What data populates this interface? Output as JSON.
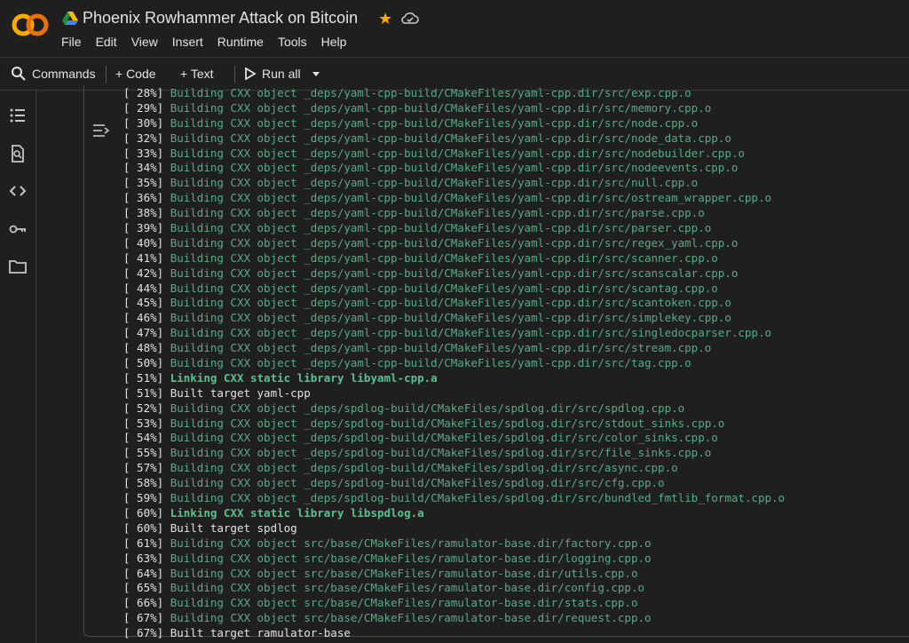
{
  "header": {
    "logo_text": "CO",
    "title": "Phoenix Rowhammer Attack on Bitcoin",
    "menu": [
      "File",
      "Edit",
      "View",
      "Insert",
      "Runtime",
      "Tools",
      "Help"
    ]
  },
  "toolbar": {
    "commands_label": "Commands",
    "code_label": "+ Code",
    "text_label": "+ Text",
    "run_all_label": "Run all"
  },
  "colors": {
    "accent_star": "#f9ab00",
    "logo_orange": "#f9ab00",
    "build_text": "#5aa987",
    "link_text": "#57c28f"
  },
  "output_lines": [
    {
      "pct": "[ 28%]",
      "msg": "Building CXX object _deps/yaml-cpp-build/CMakeFiles/yaml-cpp.dir/src/exp.cpp.o",
      "kind": "build"
    },
    {
      "pct": "[ 29%]",
      "msg": "Building CXX object _deps/yaml-cpp-build/CMakeFiles/yaml-cpp.dir/src/memory.cpp.o",
      "kind": "build"
    },
    {
      "pct": "[ 30%]",
      "msg": "Building CXX object _deps/yaml-cpp-build/CMakeFiles/yaml-cpp.dir/src/node.cpp.o",
      "kind": "build"
    },
    {
      "pct": "[ 32%]",
      "msg": "Building CXX object _deps/yaml-cpp-build/CMakeFiles/yaml-cpp.dir/src/node_data.cpp.o",
      "kind": "build"
    },
    {
      "pct": "[ 33%]",
      "msg": "Building CXX object _deps/yaml-cpp-build/CMakeFiles/yaml-cpp.dir/src/nodebuilder.cpp.o",
      "kind": "build"
    },
    {
      "pct": "[ 34%]",
      "msg": "Building CXX object _deps/yaml-cpp-build/CMakeFiles/yaml-cpp.dir/src/nodeevents.cpp.o",
      "kind": "build"
    },
    {
      "pct": "[ 35%]",
      "msg": "Building CXX object _deps/yaml-cpp-build/CMakeFiles/yaml-cpp.dir/src/null.cpp.o",
      "kind": "build"
    },
    {
      "pct": "[ 36%]",
      "msg": "Building CXX object _deps/yaml-cpp-build/CMakeFiles/yaml-cpp.dir/src/ostream_wrapper.cpp.o",
      "kind": "build"
    },
    {
      "pct": "[ 38%]",
      "msg": "Building CXX object _deps/yaml-cpp-build/CMakeFiles/yaml-cpp.dir/src/parse.cpp.o",
      "kind": "build"
    },
    {
      "pct": "[ 39%]",
      "msg": "Building CXX object _deps/yaml-cpp-build/CMakeFiles/yaml-cpp.dir/src/parser.cpp.o",
      "kind": "build"
    },
    {
      "pct": "[ 40%]",
      "msg": "Building CXX object _deps/yaml-cpp-build/CMakeFiles/yaml-cpp.dir/src/regex_yaml.cpp.o",
      "kind": "build"
    },
    {
      "pct": "[ 41%]",
      "msg": "Building CXX object _deps/yaml-cpp-build/CMakeFiles/yaml-cpp.dir/src/scanner.cpp.o",
      "kind": "build"
    },
    {
      "pct": "[ 42%]",
      "msg": "Building CXX object _deps/yaml-cpp-build/CMakeFiles/yaml-cpp.dir/src/scanscalar.cpp.o",
      "kind": "build"
    },
    {
      "pct": "[ 44%]",
      "msg": "Building CXX object _deps/yaml-cpp-build/CMakeFiles/yaml-cpp.dir/src/scantag.cpp.o",
      "kind": "build"
    },
    {
      "pct": "[ 45%]",
      "msg": "Building CXX object _deps/yaml-cpp-build/CMakeFiles/yaml-cpp.dir/src/scantoken.cpp.o",
      "kind": "build"
    },
    {
      "pct": "[ 46%]",
      "msg": "Building CXX object _deps/yaml-cpp-build/CMakeFiles/yaml-cpp.dir/src/simplekey.cpp.o",
      "kind": "build"
    },
    {
      "pct": "[ 47%]",
      "msg": "Building CXX object _deps/yaml-cpp-build/CMakeFiles/yaml-cpp.dir/src/singledocparser.cpp.o",
      "kind": "build"
    },
    {
      "pct": "[ 48%]",
      "msg": "Building CXX object _deps/yaml-cpp-build/CMakeFiles/yaml-cpp.dir/src/stream.cpp.o",
      "kind": "build"
    },
    {
      "pct": "[ 50%]",
      "msg": "Building CXX object _deps/yaml-cpp-build/CMakeFiles/yaml-cpp.dir/src/tag.cpp.o",
      "kind": "build"
    },
    {
      "pct": "[ 51%]",
      "msg": "Linking CXX static library libyaml-cpp.a",
      "kind": "link"
    },
    {
      "pct": "[ 51%]",
      "msg": "Built target yaml-cpp",
      "kind": "target"
    },
    {
      "pct": "[ 52%]",
      "msg": "Building CXX object _deps/spdlog-build/CMakeFiles/spdlog.dir/src/spdlog.cpp.o",
      "kind": "build"
    },
    {
      "pct": "[ 53%]",
      "msg": "Building CXX object _deps/spdlog-build/CMakeFiles/spdlog.dir/src/stdout_sinks.cpp.o",
      "kind": "build"
    },
    {
      "pct": "[ 54%]",
      "msg": "Building CXX object _deps/spdlog-build/CMakeFiles/spdlog.dir/src/color_sinks.cpp.o",
      "kind": "build"
    },
    {
      "pct": "[ 55%]",
      "msg": "Building CXX object _deps/spdlog-build/CMakeFiles/spdlog.dir/src/file_sinks.cpp.o",
      "kind": "build"
    },
    {
      "pct": "[ 57%]",
      "msg": "Building CXX object _deps/spdlog-build/CMakeFiles/spdlog.dir/src/async.cpp.o",
      "kind": "build"
    },
    {
      "pct": "[ 58%]",
      "msg": "Building CXX object _deps/spdlog-build/CMakeFiles/spdlog.dir/src/cfg.cpp.o",
      "kind": "build"
    },
    {
      "pct": "[ 59%]",
      "msg": "Building CXX object _deps/spdlog-build/CMakeFiles/spdlog.dir/src/bundled_fmtlib_format.cpp.o",
      "kind": "build"
    },
    {
      "pct": "[ 60%]",
      "msg": "Linking CXX static library libspdlog.a",
      "kind": "link"
    },
    {
      "pct": "[ 60%]",
      "msg": "Built target spdlog",
      "kind": "target"
    },
    {
      "pct": "[ 61%]",
      "msg": "Building CXX object src/base/CMakeFiles/ramulator-base.dir/factory.cpp.o",
      "kind": "build"
    },
    {
      "pct": "[ 63%]",
      "msg": "Building CXX object src/base/CMakeFiles/ramulator-base.dir/logging.cpp.o",
      "kind": "build"
    },
    {
      "pct": "[ 64%]",
      "msg": "Building CXX object src/base/CMakeFiles/ramulator-base.dir/utils.cpp.o",
      "kind": "build"
    },
    {
      "pct": "[ 65%]",
      "msg": "Building CXX object src/base/CMakeFiles/ramulator-base.dir/config.cpp.o",
      "kind": "build"
    },
    {
      "pct": "[ 66%]",
      "msg": "Building CXX object src/base/CMakeFiles/ramulator-base.dir/stats.cpp.o",
      "kind": "build"
    },
    {
      "pct": "[ 67%]",
      "msg": "Building CXX object src/base/CMakeFiles/ramulator-base.dir/request.cpp.o",
      "kind": "build"
    },
    {
      "pct": "[ 67%]",
      "msg": "Built target ramulator-base",
      "kind": "target"
    }
  ]
}
